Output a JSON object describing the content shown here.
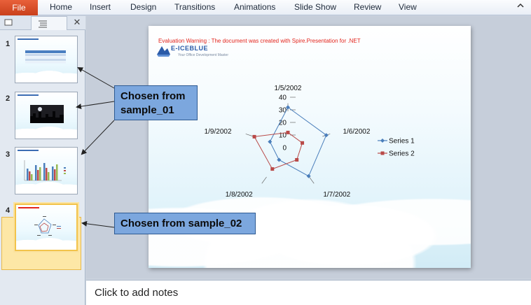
{
  "ribbon": {
    "file_label": "File",
    "tabs": [
      {
        "label": "Home"
      },
      {
        "label": "Insert"
      },
      {
        "label": "Design"
      },
      {
        "label": "Transitions"
      },
      {
        "label": "Animations"
      },
      {
        "label": "Slide Show"
      },
      {
        "label": "Review"
      },
      {
        "label": "View"
      }
    ],
    "minimize_icon": "chevron-up-icon"
  },
  "pane": {
    "tabs": [
      "slides-tab-icon",
      "outline-tab-icon"
    ],
    "close_glyph": "✕",
    "slides": [
      {
        "number": "1",
        "kind": "table"
      },
      {
        "number": "2",
        "kind": "night-city"
      },
      {
        "number": "3",
        "kind": "bar-chart"
      },
      {
        "number": "4",
        "kind": "radar-chart",
        "selected": true
      }
    ]
  },
  "slide": {
    "warning": "Evaluation Warning : The document was created with  Spire.Presentation  for .NET",
    "logo_text": "E-ICEBLUE",
    "logo_sub": "Your Office Development Master"
  },
  "chart_data": {
    "type": "radar",
    "categories": [
      "1/5/2002",
      "1/6/2002",
      "1/7/2002",
      "1/8/2002",
      "1/9/2002"
    ],
    "series": [
      {
        "name": "Series 1",
        "values": [
          32,
          32,
          28,
          12,
          15
        ],
        "color": "#4a7ebb",
        "marker": "diamond"
      },
      {
        "name": "Series 2",
        "values": [
          12,
          12,
          12,
          21,
          28
        ],
        "color": "#b94a48",
        "marker": "square"
      }
    ],
    "ticks": [
      0,
      10,
      20,
      30,
      40
    ],
    "rmax": 40,
    "legend_position": "right"
  },
  "notes": {
    "placeholder": "Click to add notes"
  },
  "callouts": [
    {
      "text": "Chosen from\nsample_01"
    },
    {
      "text": "Chosen from sample_02"
    }
  ],
  "colors": {
    "file_tab": "#d14f28",
    "callout_fill": "#7ca7de",
    "selected_thumb": "#f2c34b",
    "warning": "#e3251d"
  }
}
